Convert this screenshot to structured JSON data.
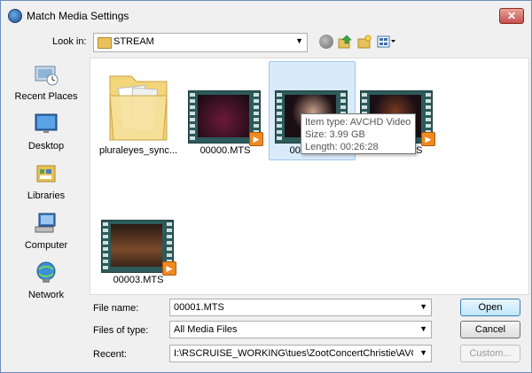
{
  "window": {
    "title": "Match Media Settings",
    "close_label": "✕"
  },
  "toolbar": {
    "lookin_label": "Look in:",
    "lookin_value": "STREAM",
    "icons": [
      "back-icon",
      "up-folder-icon",
      "new-folder-icon",
      "view-menu-icon"
    ]
  },
  "places": [
    {
      "label": "Recent Places",
      "icon": "recent-places-icon"
    },
    {
      "label": "Desktop",
      "icon": "desktop-icon"
    },
    {
      "label": "Libraries",
      "icon": "libraries-icon"
    },
    {
      "label": "Computer",
      "icon": "computer-icon"
    },
    {
      "label": "Network",
      "icon": "network-icon"
    }
  ],
  "files": [
    {
      "label": "pluraleyes_sync...",
      "kind": "folder"
    },
    {
      "label": "00000.MTS",
      "kind": "video"
    },
    {
      "label": "0001.MTS",
      "kind": "video",
      "selected": true
    },
    {
      "label": "00002.MTS",
      "kind": "video"
    },
    {
      "label": "00003.MTS",
      "kind": "video"
    }
  ],
  "tooltip": {
    "line1": "Item type: AVCHD Video",
    "line2": "Size: 3.99 GB",
    "line3": "Length: 00:26:28"
  },
  "form": {
    "filename_label": "File name:",
    "filename_value": "00001.MTS",
    "filetype_label": "Files of type:",
    "filetype_value": "All Media Files",
    "recent_label": "Recent:",
    "recent_value": "I:\\RSCRUISE_WORKING\\tues\\ZootConcertChristie\\AVCHD\\BI"
  },
  "buttons": {
    "open": "Open",
    "cancel": "Cancel",
    "custom": "Custom..."
  },
  "colors": {
    "accent": "#3c7fb1",
    "selection": "#d9ebfb",
    "play_badge": "#f08a20"
  }
}
